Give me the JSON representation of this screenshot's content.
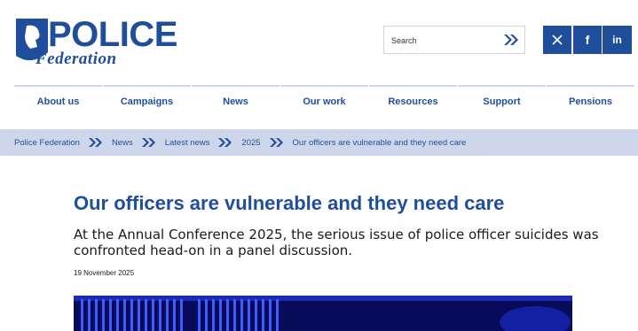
{
  "header": {
    "logo_line1": "POLICE",
    "logo_line2": "Federation",
    "search": {
      "placeholder": "Search"
    },
    "social": [
      {
        "name": "x-icon",
        "glyph": "𝕏"
      },
      {
        "name": "facebook-icon",
        "glyph": "f"
      },
      {
        "name": "linkedin-icon",
        "glyph": "in"
      }
    ]
  },
  "nav": [
    "About us",
    "Campaigns",
    "News",
    "Our work",
    "Resources",
    "Support",
    "Pensions"
  ],
  "breadcrumb": [
    "Police Federation",
    "News",
    "Latest news",
    "2025",
    "Our officers are vulnerable and they need care"
  ],
  "article": {
    "title": "Our officers are vulnerable and they need care",
    "standfirst": "At the Annual Conference 2025, the serious issue of police officer suicides was confronted head-on in a panel discussion.",
    "date": "19 November 2025"
  },
  "colors": {
    "brand": "#1f4f9c",
    "breadcrumb_bg": "#cdd6ea",
    "hero": "#0a0f6e"
  }
}
